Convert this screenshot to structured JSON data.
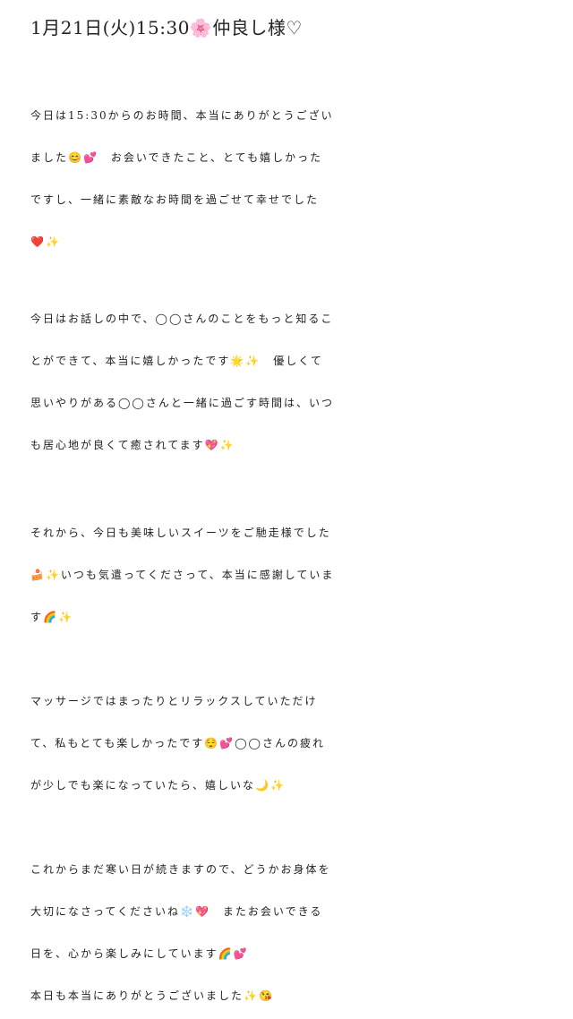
{
  "header": "1月21日(火)15:30🌸仲良し様♡",
  "paragraphs": [
    {
      "lines": [
        "今日は15:30からのお時間、本当にありがとうござい",
        "ました😊💕　お会いできたこと、とても嬉しかった",
        "ですし、一緒に素敵なお時間を過ごせて幸せでした",
        "❤️✨"
      ]
    },
    {
      "lines": [
        "今日はお話しの中で、◯◯さんのことをもっと知るこ",
        "とができて、本当に嬉しかったです🌟✨　優しくて",
        "思いやりがある◯◯さんと一緒に過ごす時間は、いつ",
        "も居心地が良くて癒されてます💖✨"
      ]
    },
    {
      "lines": [
        "それから、今日も美味しいスイーツをご馳走様でした",
        "🍰✨いつも気遣ってくださって、本当に感謝していま",
        "す🌈✨"
      ]
    },
    {
      "lines": [
        "マッサージではまったりとリラックスしていただけ",
        "て、私もとても楽しかったです😌💕◯◯さんの疲れ",
        "が少しでも楽になっていたら、嬉しいな🌙✨"
      ]
    },
    {
      "lines": [
        "これからまだ寒い日が続きますので、どうかお身体を",
        "大切になさってくださいね❄️💖　またお会いできる",
        "日を、心から楽しみにしています🌈💕",
        "本日も本当にありがとうございました✨😘"
      ]
    }
  ]
}
